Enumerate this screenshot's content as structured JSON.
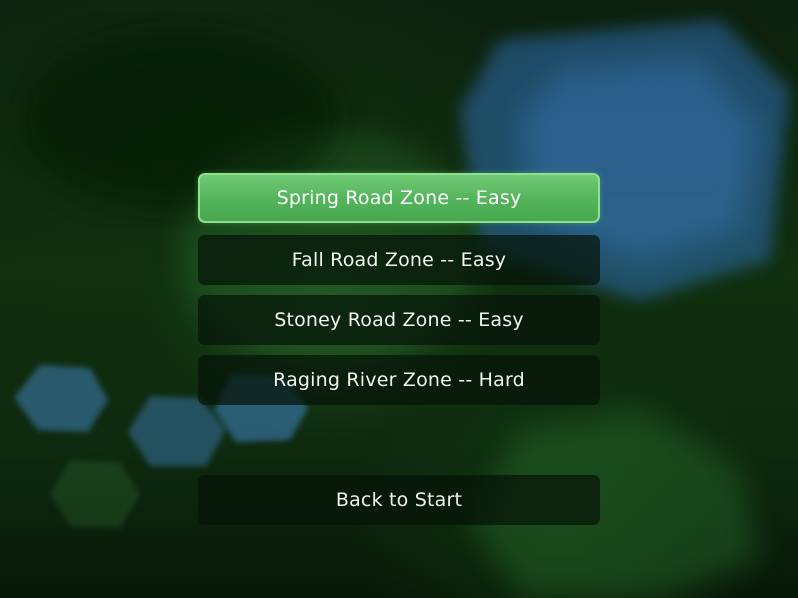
{
  "screen": {
    "name": "zone-select",
    "background": {
      "base_color": "#0b1d0c",
      "accent_blue": "#3a78c0",
      "accent_green": "#3a8a3c"
    }
  },
  "zones": [
    {
      "label": "Spring Road Zone -- Easy",
      "selected": true
    },
    {
      "label": "Fall Road Zone -- Easy",
      "selected": false
    },
    {
      "label": "Stoney Road Zone -- Easy",
      "selected": false
    },
    {
      "label": "Raging River Zone -- Hard",
      "selected": false
    }
  ],
  "back_button": {
    "label": "Back to Start"
  },
  "colors": {
    "selected_fill": "#55b55c",
    "selected_border": "#8ee08f",
    "button_fill": "#061408",
    "text": "#f2f4f2"
  }
}
